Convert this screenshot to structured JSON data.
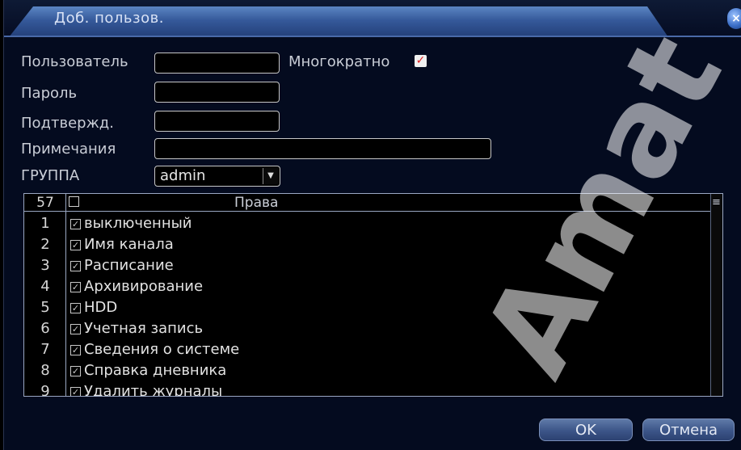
{
  "window": {
    "title": "Доб. пользов.",
    "close_label": "×"
  },
  "form": {
    "user_label": "Пользователь",
    "user_value": "",
    "multi_label": "Многократно",
    "multi_checked": true,
    "password_label": "Пароль",
    "password_value": "",
    "confirm_label": "Подтвержд.",
    "confirm_value": "",
    "notes_label": "Примечания",
    "notes_value": "",
    "group_label": "ГРУППА",
    "group_value": "admin"
  },
  "rights_table": {
    "count": "57",
    "header": "Права",
    "rows": [
      {
        "num": "1",
        "label": "выключенный",
        "checked": true
      },
      {
        "num": "2",
        "label": "Имя канала",
        "checked": true
      },
      {
        "num": "3",
        "label": "Расписание",
        "checked": true
      },
      {
        "num": "4",
        "label": "Архивирование",
        "checked": true
      },
      {
        "num": "5",
        "label": "HDD",
        "checked": true
      },
      {
        "num": "6",
        "label": "Учетная запись",
        "checked": true
      },
      {
        "num": "7",
        "label": "Сведения о системе",
        "checked": true
      },
      {
        "num": "8",
        "label": "Справка дневника",
        "checked": true
      },
      {
        "num": "9",
        "label": "Удалить журналы",
        "checked": true
      }
    ]
  },
  "buttons": {
    "ok": "OK",
    "cancel": "Отмена"
  },
  "watermark": "Amat"
}
